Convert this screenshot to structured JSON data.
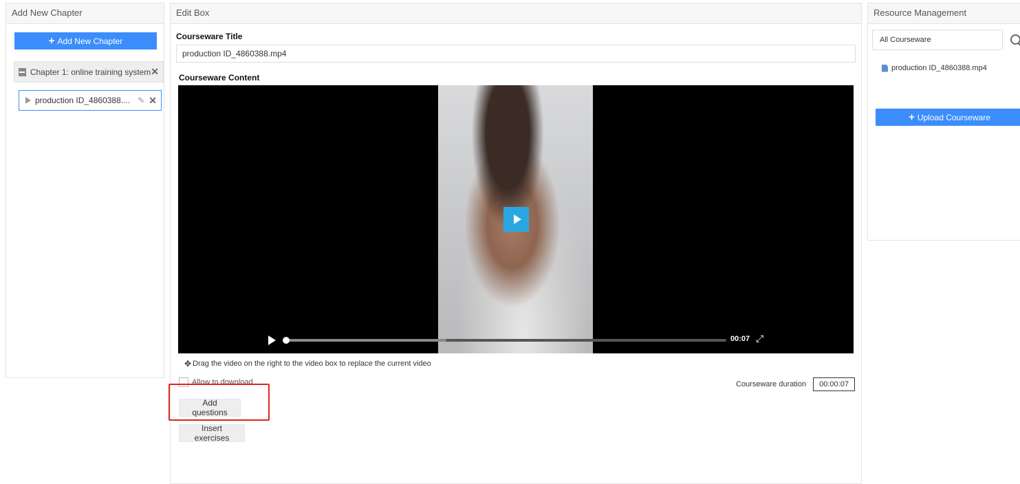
{
  "left_panel": {
    "title": "Add New Chapter",
    "add_button_label": "Add New Chapter",
    "chapter_label": "Chapter 1: online training system",
    "lesson_label": "production ID_4860388...."
  },
  "edit_box": {
    "title": "Edit Box",
    "courseware_title_label": "Courseware Title",
    "courseware_title_value": "production ID_4860388.mp4",
    "courseware_content_label": "Courseware Content",
    "video_time": "00:07",
    "video_progress": 0.0,
    "drag_hint": "Drag the video on the right to the video box to replace the current video",
    "allow_download_label": "Allow to download",
    "allow_download_checked": false,
    "duration_label": "Courseware duration",
    "duration_value": "00:00:07",
    "add_questions_label": "Add questions",
    "insert_exercises_label": "Insert exercises"
  },
  "resource_panel": {
    "title": "Resource Management",
    "filter_value": "All Courseware",
    "file_name": "production ID_4860388.mp4",
    "upload_button_label": "Upload Courseware"
  },
  "colors": {
    "primary": "#3c8dfc",
    "play_button": "#2aa7e3",
    "highlight_box": "#e0231b"
  }
}
